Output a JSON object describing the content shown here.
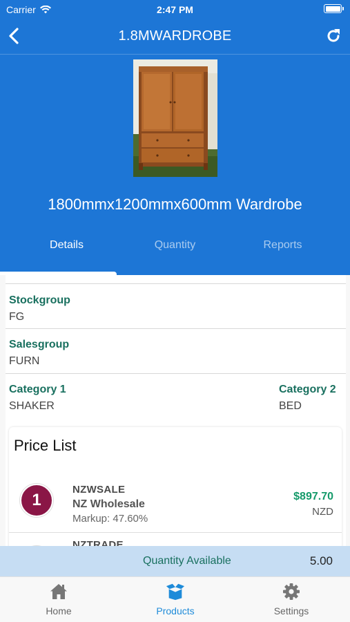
{
  "status_bar": {
    "carrier": "Carrier",
    "time": "2:47 PM"
  },
  "nav": {
    "title": "1.8MWARDROBE"
  },
  "product": {
    "name": "1800mmx1200mmx600mm Wardrobe"
  },
  "tabs": [
    {
      "label": "Details",
      "active": true
    },
    {
      "label": "Quantity",
      "active": false
    },
    {
      "label": "Reports",
      "active": false
    }
  ],
  "details": {
    "stockgroup": {
      "label": "Stockgroup",
      "value": "FG"
    },
    "salesgroup": {
      "label": "Salesgroup",
      "value": "FURN"
    },
    "category1": {
      "label": "Category 1",
      "value": "SHAKER"
    },
    "category2": {
      "label": "Category 2",
      "value": "BED"
    }
  },
  "price_list": {
    "title": "Price List",
    "items": [
      {
        "badge": "1",
        "code": "NZWSALE",
        "name": "NZ Wholesale",
        "markup": "Markup: 47.60%",
        "amount": "$897.70",
        "currency": "NZD",
        "badge_color": "#8a1646"
      },
      {
        "badge": "",
        "code": "NZTRADE",
        "name": "",
        "markup": "",
        "amount": "",
        "currency": "",
        "badge_color": "#6a2a8c"
      }
    ]
  },
  "quantity_bar": {
    "label": "Quantity Available",
    "value": "5.00"
  },
  "tabbar": [
    {
      "label": "Home",
      "icon": "home-icon",
      "active": false
    },
    {
      "label": "Products",
      "icon": "box-icon",
      "active": true
    },
    {
      "label": "Settings",
      "icon": "gear-icon",
      "active": false
    }
  ],
  "colors": {
    "header_blue": "#1d76d6",
    "label_green": "#19705f",
    "price_green": "#159a6a",
    "active_tab": "#1e8bd9"
  }
}
